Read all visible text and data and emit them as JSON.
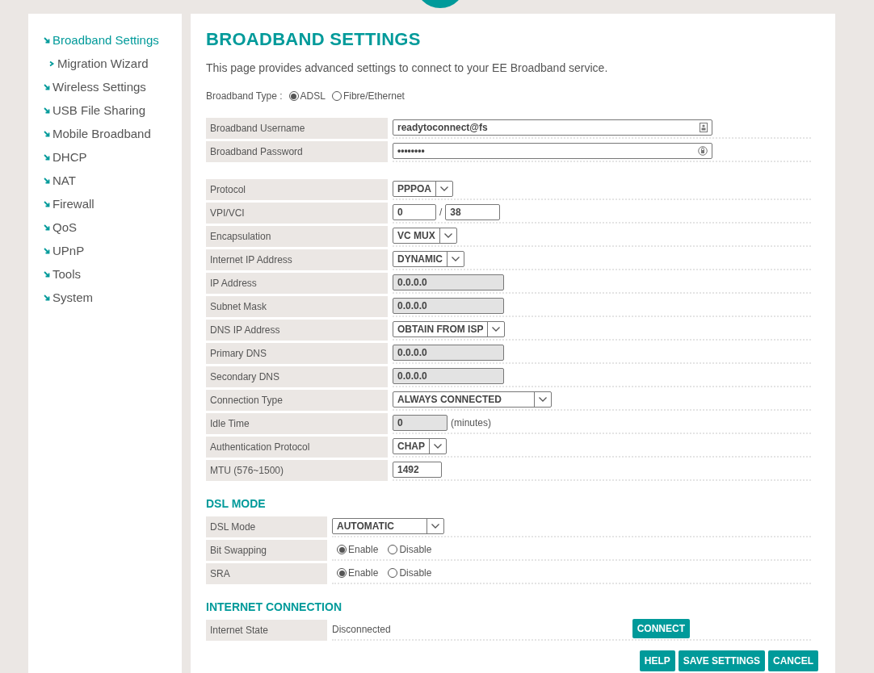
{
  "sidebar": {
    "items": [
      {
        "label": "Broadband Settings",
        "selected": true,
        "children": [
          {
            "label": "Migration Wizard",
            "selected": false
          }
        ]
      },
      {
        "label": "Wireless Settings",
        "selected": false
      },
      {
        "label": "USB File Sharing",
        "selected": false
      },
      {
        "label": "Mobile Broadband",
        "selected": false
      },
      {
        "label": "DHCP",
        "selected": false
      },
      {
        "label": "NAT",
        "selected": false
      },
      {
        "label": "Firewall",
        "selected": false
      },
      {
        "label": "QoS",
        "selected": false
      },
      {
        "label": "UPnP",
        "selected": false
      },
      {
        "label": "Tools",
        "selected": false
      },
      {
        "label": "System",
        "selected": false
      }
    ]
  },
  "page": {
    "title": "BROADBAND SETTINGS",
    "intro": "This page provides advanced settings to connect to your EE Broadband service.",
    "broadband_type": {
      "label": "Broadband Type :",
      "options": [
        {
          "label": "ADSL",
          "selected": true
        },
        {
          "label": "Fibre/Ethernet",
          "selected": false
        }
      ]
    }
  },
  "account": {
    "rows": [
      {
        "label": "Broadband Username",
        "kind": "username",
        "value": "readytoconnect@fs"
      },
      {
        "label": "Broadband Password",
        "kind": "password",
        "value": "••••••••"
      }
    ]
  },
  "connection": {
    "rows": [
      {
        "label": "Protocol",
        "kind": "select",
        "value": "PPPOA"
      },
      {
        "label": "VPI/VCI",
        "kind": "pair",
        "value": "0",
        "separator": "/",
        "value_2": "38"
      },
      {
        "label": "Encapsulation",
        "kind": "select",
        "value": "VC MUX"
      },
      {
        "label": "Internet IP Address",
        "kind": "select",
        "value": "DYNAMIC"
      },
      {
        "label": "IP Address",
        "kind": "readonly",
        "value": "0.0.0.0"
      },
      {
        "label": "Subnet Mask",
        "kind": "readonly",
        "value": "0.0.0.0"
      },
      {
        "label": "DNS IP Address",
        "kind": "select",
        "value": "OBTAIN FROM ISP"
      },
      {
        "label": "Primary DNS",
        "kind": "readonly",
        "value": "0.0.0.0"
      },
      {
        "label": "Secondary DNS",
        "kind": "readonly",
        "value": "0.0.0.0"
      },
      {
        "label": "Connection Type",
        "kind": "wideselect",
        "value": "ALWAYS CONNECTED"
      },
      {
        "label": "Idle Time",
        "kind": "unit",
        "value": "0",
        "unit": "(minutes)"
      },
      {
        "label": "Authentication Protocol",
        "kind": "select",
        "value": "CHAP"
      },
      {
        "label": "MTU (576~1500)",
        "kind": "short",
        "value": "1492"
      }
    ]
  },
  "dsl_mode": {
    "heading": "DSL MODE",
    "rows": [
      {
        "label": "DSL Mode",
        "kind": "wideselect",
        "value": "AUTOMATIC"
      },
      {
        "label": "Bit Swapping",
        "kind": "radio",
        "options": [
          {
            "label": "Enable",
            "selected": true
          },
          {
            "label": "Disable",
            "selected": false
          }
        ]
      },
      {
        "label": "SRA",
        "kind": "radio",
        "options": [
          {
            "label": "Enable",
            "selected": true
          },
          {
            "label": "Disable",
            "selected": false
          }
        ]
      }
    ]
  },
  "internet_connection": {
    "heading": "INTERNET CONNECTION",
    "rows": [
      {
        "label": "Internet State",
        "kind": "status",
        "value": "Disconnected",
        "button": "CONNECT"
      }
    ]
  },
  "buttons": [
    "HELP",
    "SAVE SETTINGS",
    "CANCEL"
  ]
}
